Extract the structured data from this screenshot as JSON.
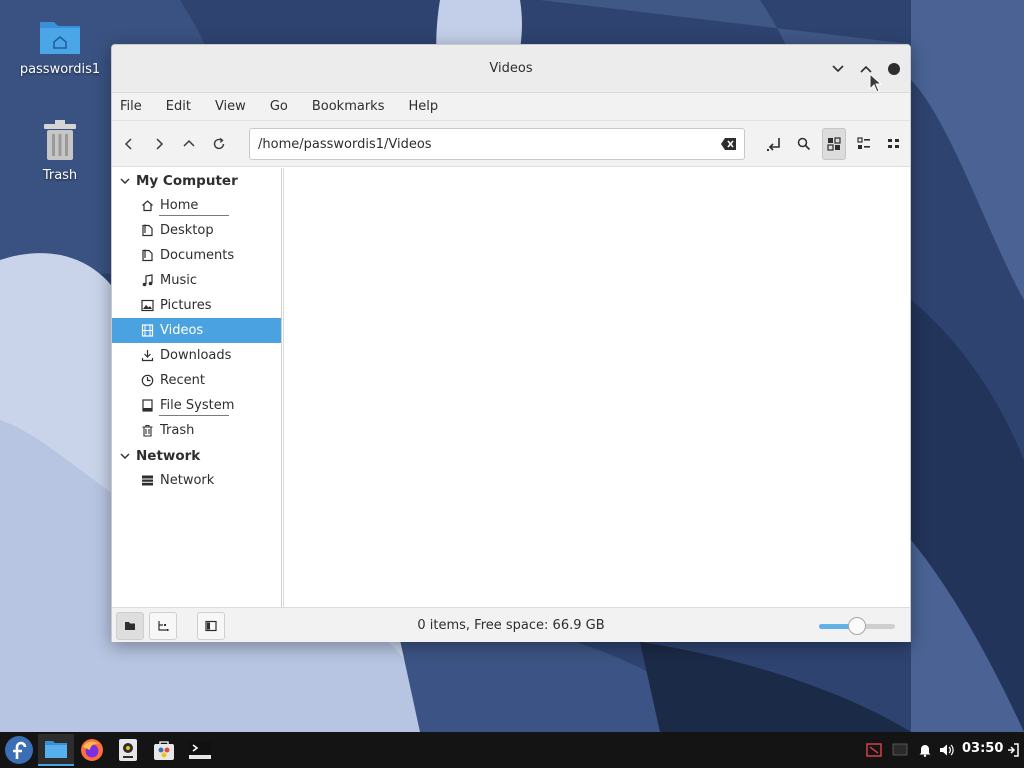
{
  "desktop": {
    "icons": [
      {
        "label": "passwordis1",
        "icon": "home-folder-icon"
      },
      {
        "label": "Trash",
        "icon": "trash-icon"
      }
    ]
  },
  "window": {
    "title": "Videos",
    "controls": [
      "minimize",
      "maximize",
      "close"
    ]
  },
  "menu": [
    "File",
    "Edit",
    "View",
    "Go",
    "Bookmarks",
    "Help"
  ],
  "toolbar": {
    "path": "/home/passwordis1/Videos",
    "active_view": "icon-view"
  },
  "sidebar": {
    "sections": [
      {
        "title": "My Computer",
        "items": [
          {
            "label": "Home",
            "icon": "home-icon"
          },
          {
            "label": "Desktop",
            "icon": "desktop-icon"
          },
          {
            "label": "Documents",
            "icon": "documents-icon"
          },
          {
            "label": "Music",
            "icon": "music-icon"
          },
          {
            "label": "Pictures",
            "icon": "pictures-icon"
          },
          {
            "label": "Videos",
            "icon": "videos-icon",
            "selected": true
          },
          {
            "label": "Downloads",
            "icon": "downloads-icon"
          },
          {
            "label": "Recent",
            "icon": "recent-icon"
          },
          {
            "label": "File System",
            "icon": "filesystem-icon"
          },
          {
            "label": "Trash",
            "icon": "trash-icon"
          }
        ]
      },
      {
        "title": "Network",
        "items": [
          {
            "label": "Network",
            "icon": "network-icon"
          }
        ]
      }
    ]
  },
  "status": {
    "text": "0 items, Free space: 66.9 GB",
    "zoom_fraction": 0.5
  },
  "taskbar": {
    "clock": "03:50",
    "apps": [
      "fedora-menu-icon",
      "file-manager-icon",
      "firefox-icon",
      "media-icon",
      "software-icon",
      "terminal-icon"
    ],
    "tray": [
      "screen-record-icon",
      "display-icon",
      "notification-bell-icon",
      "volume-icon",
      "logout-icon"
    ]
  },
  "colors": {
    "accent": "#4aa3e0",
    "wallpaper_dark": "#2b3f66",
    "taskbar": "#141414"
  }
}
